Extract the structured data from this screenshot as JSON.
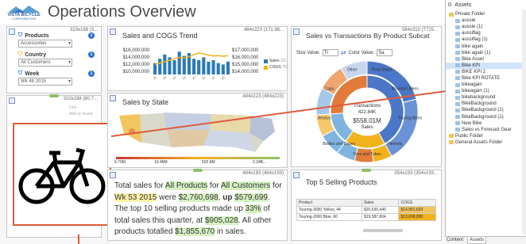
{
  "header": {
    "logo_line1": "VISTA BICYCLE",
    "logo_line2": "CORPORATION",
    "title": "Operations Overview"
  },
  "filters": {
    "dims": "310x188 (3...",
    "items": [
      {
        "label": "Products",
        "value": "Accessories",
        "badge": "1"
      },
      {
        "label": "Country",
        "value": "All Customers",
        "badge": "1"
      },
      {
        "label": "Week",
        "value": "Wk 48 2015",
        "badge": "1"
      }
    ]
  },
  "image_panel": {
    "dims": "310x188 (80.7...",
    "links": [
      "Link",
      "Add an Asset"
    ]
  },
  "sales_cogs": {
    "title": "Sales and COGS Trend",
    "dims": "484x223 (171.98...",
    "chart_data": {
      "type": "bar",
      "title": "Sales and COGS Trend",
      "left_axis_ticks": [
        "$16,000,000",
        "$14,000,000",
        "$12,000,000",
        "$10,000,000"
      ],
      "right_axis_ticks": [
        "$17,000,000",
        "$16,000,000",
        "$15,000,000",
        "$14,000,000"
      ],
      "bar_values": [
        0.4,
        0.55,
        0.7,
        0.6,
        0.5,
        0.8,
        0.65,
        0.75,
        0.55,
        0.5,
        0.6,
        0.45,
        0.5,
        0.4,
        0.35,
        0.45
      ],
      "line_values": [
        0.35,
        0.4,
        0.45,
        0.5,
        0.55,
        0.6,
        0.58,
        0.62,
        0.7,
        0.75,
        0.72,
        0.68,
        0.65,
        0.66,
        0.64,
        0.66
      ],
      "legend": [
        "Sales",
        "COGS"
      ],
      "legend_suffix": [
        "DC",
        "PC"
      ],
      "colors": {
        "bars": "#2a7ab8",
        "line": "#f2b21c"
      }
    }
  },
  "sales_state": {
    "title": "Sales by State",
    "dims": "484x223 (484x223)",
    "scale": [
      "6.79M",
      "10.48M",
      "502.8M",
      "2.34B..."
    ]
  },
  "sunburst": {
    "title": "Sales vs Transactions By Product Subcat",
    "dims": "584x310 (7725...",
    "size_label": "Size Value:",
    "size_value": "Tr",
    "color_label": "Color Value:",
    "color_value": "Sa",
    "center": {
      "line1": "Transactions",
      "line2": "422.84K",
      "line3": "$558.01M",
      "line4": "Sales"
    },
    "chart_data": {
      "type": "pie",
      "inner": [
        {
          "name": "Bikes",
          "value": 42,
          "color": "#4a77c8"
        },
        {
          "name": "Accessories",
          "value": 18,
          "color": "#f2b21c"
        },
        {
          "name": "Clothing",
          "value": 14,
          "color": "#7fb4e0"
        },
        {
          "name": "Components",
          "value": 26,
          "color": "#e07b3a"
        }
      ],
      "outer_labels": [
        "Road Bikes",
        "Mountain Bikes",
        "Touring Bikes",
        "Helmets",
        "Tires and Tubes",
        "Bottles and Cages",
        "Jerseys",
        "Caps",
        "Other"
      ]
    }
  },
  "narrative": {
    "dims": "484x193 (484x193)",
    "p1": "Total sales for ",
    "v1": "All Products",
    "p2": " for ",
    "v2": "All Customers",
    "p3": " for ",
    "v3": "Wk 53 2015",
    "p4": " were ",
    "v4": "$2,760,698",
    "p5": ", ",
    "v5": "up",
    "p6": " ",
    "v6": "$579,699",
    "p7": ". The top 10 selling products made up ",
    "v7": "33%",
    "p8": " of total sales this quarter, at ",
    "v8": "$905,028",
    "p9": ".  All other products totalled ",
    "v9": "$1,855,670",
    "p10": " in sales."
  },
  "top5": {
    "title": "Top 5 Selling Products",
    "dims": "354x193 (354x193...",
    "columns": [
      "Product",
      "Sales",
      "COGS"
    ],
    "rows": [
      {
        "product": "Touring-3000 Yellow, 44",
        "sales": "$20,536,440",
        "cogs": "$14,951,693"
      },
      {
        "product": "Touring-2000 Blue, 60",
        "sales": "$19,587,804",
        "cogs": "$13,898,885"
      }
    ]
  },
  "assets": {
    "title": "Assets",
    "root": "Private Folder",
    "items": [
      "aussie",
      "aussie (1)",
      "aussiflag",
      "aussiflag (1)",
      "bike again",
      "bike again (1)",
      "Bike Asset",
      "Bike KPI",
      "BIKE KPI 2",
      "Bike KPI ROTATE",
      "bikeagain",
      "bikeagain (1)",
      "bikebackground",
      "BikeBackground",
      "BikeBackground (1)",
      "BikeBackground (1)",
      "New Bike",
      "Sales vs Forecast Gear"
    ],
    "selected": "Bike KPI",
    "folders": [
      "Public Folder",
      "General Assets Folder"
    ],
    "tabs": [
      "Content",
      "Assets"
    ]
  },
  "colors": {
    "accent": "#2c6fd1",
    "connector": "#e15a3a",
    "selection": "#d0e4fa"
  }
}
